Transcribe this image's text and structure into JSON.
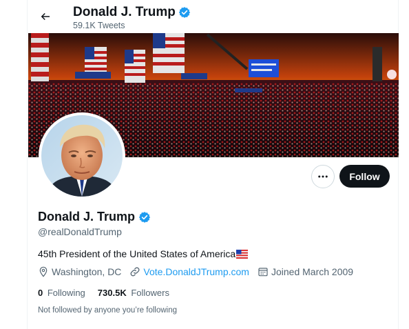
{
  "header": {
    "back_icon": "arrow-left-icon",
    "title": "Donald J. Trump",
    "tweet_count": "59.1K Tweets"
  },
  "profile": {
    "name": "Donald J. Trump",
    "handle": "@realDonaldTrump",
    "verified_icon": "verified-badge-icon",
    "bio": "45th President of the United States of America",
    "bio_emoji": "us-flag-icon",
    "location": "Washington, DC",
    "website": "Vote.DonaldJTrump.com",
    "joined": "Joined March 2009"
  },
  "actions": {
    "more_icon": "more-horizontal-icon",
    "follow_label": "Follow"
  },
  "stats": {
    "following_count": "0",
    "following_label": "Following",
    "followers_count": "730.5K",
    "followers_label": "Followers"
  },
  "social_context": "Not followed by anyone you’re following",
  "colors": {
    "accent": "#1d9bf0",
    "text_primary": "#0f1419",
    "text_secondary": "#536471",
    "follow_button": "#0f1419"
  }
}
